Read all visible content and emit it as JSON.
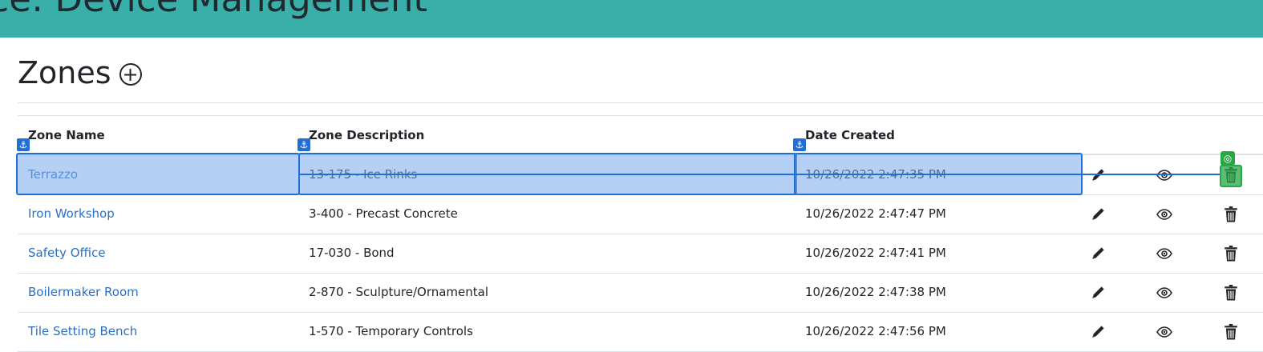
{
  "header": {
    "title": "nce: Device Management"
  },
  "page": {
    "title": "Zones",
    "add_label": "+"
  },
  "table": {
    "columns": [
      "Zone Name",
      "Zone Description",
      "Date Created"
    ],
    "rows": [
      {
        "name": "Terrazzo",
        "description": "13-175 - Ice Rinks",
        "date": "10/26/2022 2:47:35 PM"
      },
      {
        "name": "Iron Workshop",
        "description": "3-400 - Precast Concrete",
        "date": "10/26/2022 2:47:47 PM"
      },
      {
        "name": "Safety Office",
        "description": "17-030 - Bond",
        "date": "10/26/2022 2:47:41 PM"
      },
      {
        "name": "Boilermaker Room",
        "description": "2-870 - Sculpture/Ornamental",
        "date": "10/26/2022 2:47:38 PM"
      },
      {
        "name": "Tile Setting Bench",
        "description": "1-570 - Temporary Controls",
        "date": "10/26/2022 2:47:56 PM"
      }
    ],
    "actions": [
      "edit-icon",
      "view-icon",
      "delete-icon"
    ]
  },
  "overlay": {
    "anchor_glyph": "⚓",
    "target_glyph": "◎"
  },
  "colors": {
    "topbar": "#3aafa9",
    "link": "#2a6fc6",
    "selection": "#1f6fd6",
    "target": "#28a745"
  }
}
